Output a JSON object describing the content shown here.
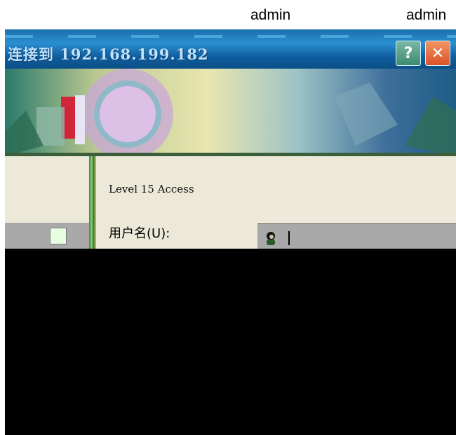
{
  "captions": [
    "admin",
    "admin"
  ],
  "dialog": {
    "title": "连接到 192.168.199.182",
    "help_label": "?",
    "close_label": "✕",
    "realm": "Level 15 Access",
    "username_label": "用户名(U):",
    "username_value": ""
  },
  "icons": {
    "help": "help-icon",
    "close": "close-icon",
    "user": "user-icon",
    "list": "list-icon"
  },
  "colors": {
    "titlebar": "#1a6fae",
    "close": "#d9542a",
    "dialog_bg": "#ece9d8"
  }
}
